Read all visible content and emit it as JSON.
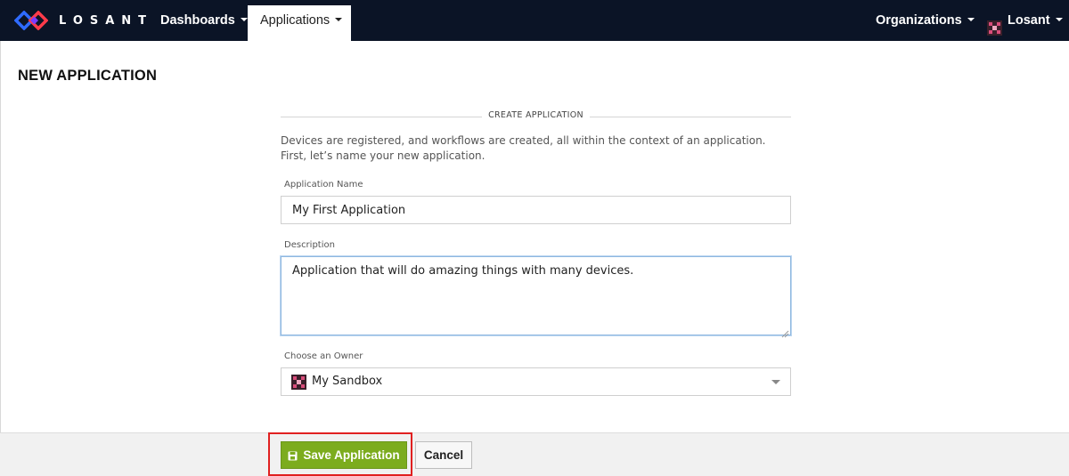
{
  "brand": {
    "name": "LOSANT",
    "logo_icon": "losant-logo-icon"
  },
  "nav": {
    "dashboards": "Dashboards",
    "applications": "Applications",
    "organizations": "Organizations",
    "user": "Losant"
  },
  "page": {
    "title": "NEW APPLICATION"
  },
  "form": {
    "section_title": "CREATE APPLICATION",
    "intro": "Devices are registered, and workflows are created, all within the context of an application. First, let’s name your new application.",
    "name_label": "Application Name",
    "name_value": "My First Application",
    "description_label": "Description",
    "description_value": "Application that will do amazing things with many devices.",
    "owner_label": "Choose an Owner",
    "owner_value": "My Sandbox"
  },
  "actions": {
    "save_label": "Save Application",
    "cancel_label": "Cancel"
  },
  "colors": {
    "nav_bg": "#0b1426",
    "accent_green": "#7cac1e",
    "highlight_red": "#e02020",
    "logo_blue": "#2f6bff",
    "logo_red": "#ff3b4a"
  }
}
